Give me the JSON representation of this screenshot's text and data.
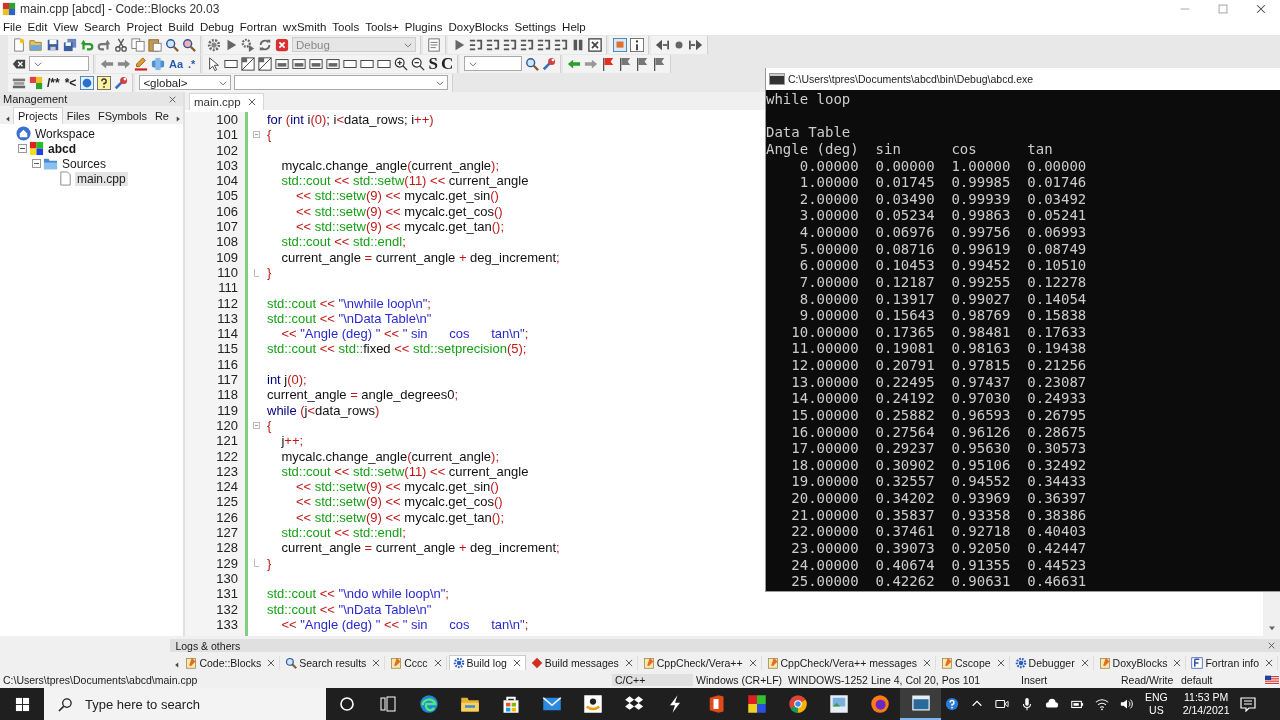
{
  "window": {
    "title": "main.cpp [abcd] - Code::Blocks 20.03"
  },
  "menu": [
    "File",
    "Edit",
    "View",
    "Search",
    "Project",
    "Build",
    "Debug",
    "Fortran",
    "wxSmith",
    "Tools",
    "Tools+",
    "Plugins",
    "DoxyBlocks",
    "Settings",
    "Help"
  ],
  "toolbar": {
    "build_target": "Debug",
    "match_case": "Aa",
    "regex": ".*",
    "letter_s": "S",
    "letter_c": "C",
    "doc_block": "/**",
    "doc_inline": "*<",
    "scope": "<global>"
  },
  "management": {
    "title": "Management",
    "tabs": [
      {
        "label": "Projects",
        "selected": true
      },
      {
        "label": "Files",
        "selected": false
      },
      {
        "label": "FSymbols",
        "selected": false
      },
      {
        "label": "Re",
        "selected": false
      }
    ],
    "tree": [
      {
        "label": "Workspace",
        "kind": "workspace",
        "selected": false,
        "children": [
          {
            "label": "abcd",
            "kind": "project",
            "selected": false,
            "expanded": true,
            "children": [
              {
                "label": "Sources",
                "kind": "folder",
                "selected": false,
                "expanded": true,
                "children": [
                  {
                    "label": "main.cpp",
                    "kind": "file",
                    "selected": true
                  }
                ]
              }
            ]
          }
        ]
      }
    ]
  },
  "editor": {
    "tabs": [
      {
        "label": "main.cpp",
        "selected": true
      }
    ],
    "lines": [
      {
        "number": "100",
        "tokens": [
          {
            "text": "for ",
            "kind": "keyword"
          },
          {
            "text": "(",
            "kind": "operator"
          },
          {
            "text": "int",
            "kind": "keyword"
          },
          {
            "text": " i",
            "kind": "plain"
          },
          {
            "text": "(0)",
            "kind": "operator"
          },
          {
            "text": "; i",
            "kind": "plain"
          },
          {
            "text": "<",
            "kind": "operator"
          },
          {
            "text": "data_rows; i",
            "kind": "plain"
          },
          {
            "text": "++)",
            "kind": "operator"
          }
        ]
      },
      {
        "number": "101",
        "fold_open": true,
        "tokens": [
          {
            "text": "{",
            "kind": "operator"
          }
        ]
      },
      {
        "number": "102"
      },
      {
        "number": "103",
        "tokens": [
          {
            "text": "    mycalc.change_angle",
            "kind": "plain"
          },
          {
            "text": "(",
            "kind": "operator"
          },
          {
            "text": "current_angle",
            "kind": "plain"
          },
          {
            "text": ");",
            "kind": "operator"
          }
        ]
      },
      {
        "number": "104",
        "tokens": [
          {
            "text": "    std::cout ",
            "kind": "library"
          },
          {
            "text": "<< ",
            "kind": "operator"
          },
          {
            "text": "std::setw",
            "kind": "library"
          },
          {
            "text": "(11) <<",
            "kind": "operator"
          },
          {
            "text": " current_angle",
            "kind": "plain"
          }
        ]
      },
      {
        "number": "105",
        "tokens": [
          {
            "text": "        << ",
            "kind": "operator"
          },
          {
            "text": "std::setw",
            "kind": "library"
          },
          {
            "text": "(9) <<",
            "kind": "operator"
          },
          {
            "text": " mycalc.get_sin",
            "kind": "plain"
          },
          {
            "text": "()",
            "kind": "operator"
          }
        ]
      },
      {
        "number": "106",
        "tokens": [
          {
            "text": "        << ",
            "kind": "operator"
          },
          {
            "text": "std::setw",
            "kind": "library"
          },
          {
            "text": "(9) <<",
            "kind": "operator"
          },
          {
            "text": " mycalc.get_cos",
            "kind": "plain"
          },
          {
            "text": "()",
            "kind": "operator"
          }
        ]
      },
      {
        "number": "107",
        "tokens": [
          {
            "text": "        << ",
            "kind": "operator"
          },
          {
            "text": "std::setw",
            "kind": "library"
          },
          {
            "text": "(9) <<",
            "kind": "operator"
          },
          {
            "text": " mycalc.get_tan",
            "kind": "plain"
          },
          {
            "text": "();",
            "kind": "operator"
          }
        ]
      },
      {
        "number": "108",
        "tokens": [
          {
            "text": "    std::cout ",
            "kind": "library"
          },
          {
            "text": "<< ",
            "kind": "operator"
          },
          {
            "text": "std::endl",
            "kind": "library"
          },
          {
            "text": ";",
            "kind": "operator"
          }
        ]
      },
      {
        "number": "109",
        "tokens": [
          {
            "text": "    current_angle ",
            "kind": "plain"
          },
          {
            "text": "=",
            "kind": "operator"
          },
          {
            "text": " current_angle ",
            "kind": "plain"
          },
          {
            "text": "+",
            "kind": "operator"
          },
          {
            "text": " deg_increment",
            "kind": "plain"
          },
          {
            "text": ";",
            "kind": "operator"
          }
        ]
      },
      {
        "number": "110",
        "fold_close": true,
        "tokens": [
          {
            "text": "}",
            "kind": "operator"
          }
        ]
      },
      {
        "number": "111"
      },
      {
        "number": "112",
        "tokens": [
          {
            "text": "std::cout ",
            "kind": "library"
          },
          {
            "text": "<< ",
            "kind": "operator"
          },
          {
            "text": "\"\\nwhile loop\\n\"",
            "kind": "string"
          },
          {
            "text": ";",
            "kind": "operator"
          }
        ]
      },
      {
        "number": "113",
        "tokens": [
          {
            "text": "std::cout ",
            "kind": "library"
          },
          {
            "text": "<< ",
            "kind": "operator"
          },
          {
            "text": "\"\\nData Table\\n\"",
            "kind": "string"
          }
        ]
      },
      {
        "number": "114",
        "tokens": [
          {
            "text": "    << ",
            "kind": "operator"
          },
          {
            "text": "\"Angle (deg) \" ",
            "kind": "string"
          },
          {
            "text": "<< ",
            "kind": "operator"
          },
          {
            "text": "\" sin      cos      tan\\n\"",
            "kind": "string"
          },
          {
            "text": ";",
            "kind": "operator"
          }
        ]
      },
      {
        "number": "115",
        "tokens": [
          {
            "text": "std::cout ",
            "kind": "library"
          },
          {
            "text": "<< ",
            "kind": "operator"
          },
          {
            "text": "std::",
            "kind": "library"
          },
          {
            "text": "fixed ",
            "kind": "plain"
          },
          {
            "text": "<< ",
            "kind": "operator"
          },
          {
            "text": "std::setprecision",
            "kind": "library"
          },
          {
            "text": "(5);",
            "kind": "operator"
          }
        ]
      },
      {
        "number": "116"
      },
      {
        "number": "117",
        "tokens": [
          {
            "text": "int",
            "kind": "keyword"
          },
          {
            "text": " j",
            "kind": "plain"
          },
          {
            "text": "(0);",
            "kind": "operator"
          }
        ]
      },
      {
        "number": "118",
        "tokens": [
          {
            "text": "current_angle ",
            "kind": "plain"
          },
          {
            "text": "=",
            "kind": "operator"
          },
          {
            "text": " angle_degrees0",
            "kind": "plain"
          },
          {
            "text": ";",
            "kind": "operator"
          }
        ]
      },
      {
        "number": "119",
        "tokens": [
          {
            "text": "while ",
            "kind": "keyword"
          },
          {
            "text": "(",
            "kind": "operator"
          },
          {
            "text": "j",
            "kind": "plain"
          },
          {
            "text": "<",
            "kind": "operator"
          },
          {
            "text": "data_rows",
            "kind": "plain"
          },
          {
            "text": ")",
            "kind": "operator"
          }
        ]
      },
      {
        "number": "120",
        "fold_open": true,
        "tokens": [
          {
            "text": "{",
            "kind": "operator"
          }
        ]
      },
      {
        "number": "121",
        "tokens": [
          {
            "text": "    j",
            "kind": "plain"
          },
          {
            "text": "++;",
            "kind": "operator"
          }
        ]
      },
      {
        "number": "122",
        "tokens": [
          {
            "text": "    mycalc.change_angle",
            "kind": "plain"
          },
          {
            "text": "(",
            "kind": "operator"
          },
          {
            "text": "current_angle",
            "kind": "plain"
          },
          {
            "text": ");",
            "kind": "operator"
          }
        ]
      },
      {
        "number": "123",
        "tokens": [
          {
            "text": "    std::cout ",
            "kind": "library"
          },
          {
            "text": "<< ",
            "kind": "operator"
          },
          {
            "text": "std::setw",
            "kind": "library"
          },
          {
            "text": "(11) <<",
            "kind": "operator"
          },
          {
            "text": " current_angle",
            "kind": "plain"
          }
        ]
      },
      {
        "number": "124",
        "tokens": [
          {
            "text": "        << ",
            "kind": "operator"
          },
          {
            "text": "std::setw",
            "kind": "library"
          },
          {
            "text": "(9) <<",
            "kind": "operator"
          },
          {
            "text": " mycalc.get_sin",
            "kind": "plain"
          },
          {
            "text": "()",
            "kind": "operator"
          }
        ]
      },
      {
        "number": "125",
        "tokens": [
          {
            "text": "        << ",
            "kind": "operator"
          },
          {
            "text": "std::setw",
            "kind": "library"
          },
          {
            "text": "(9) <<",
            "kind": "operator"
          },
          {
            "text": " mycalc.get_cos",
            "kind": "plain"
          },
          {
            "text": "()",
            "kind": "operator"
          }
        ]
      },
      {
        "number": "126",
        "tokens": [
          {
            "text": "        << ",
            "kind": "operator"
          },
          {
            "text": "std::setw",
            "kind": "library"
          },
          {
            "text": "(9) <<",
            "kind": "operator"
          },
          {
            "text": " mycalc.get_tan",
            "kind": "plain"
          },
          {
            "text": "();",
            "kind": "operator"
          }
        ]
      },
      {
        "number": "127",
        "tokens": [
          {
            "text": "    std::cout ",
            "kind": "library"
          },
          {
            "text": "<< ",
            "kind": "operator"
          },
          {
            "text": "std::endl",
            "kind": "library"
          },
          {
            "text": ";",
            "kind": "operator"
          }
        ]
      },
      {
        "number": "128",
        "tokens": [
          {
            "text": "    current_angle ",
            "kind": "plain"
          },
          {
            "text": "=",
            "kind": "operator"
          },
          {
            "text": " current_angle ",
            "kind": "plain"
          },
          {
            "text": "+",
            "kind": "operator"
          },
          {
            "text": " deg_increment",
            "kind": "plain"
          },
          {
            "text": ";",
            "kind": "operator"
          }
        ]
      },
      {
        "number": "129",
        "fold_close": true,
        "tokens": [
          {
            "text": "}",
            "kind": "operator"
          }
        ]
      },
      {
        "number": "130"
      },
      {
        "number": "131",
        "tokens": [
          {
            "text": "std::cout ",
            "kind": "library"
          },
          {
            "text": "<< ",
            "kind": "operator"
          },
          {
            "text": "\"\\ndo while loop\\n\"",
            "kind": "string"
          },
          {
            "text": ";",
            "kind": "operator"
          }
        ]
      },
      {
        "number": "132",
        "tokens": [
          {
            "text": "std::cout ",
            "kind": "library"
          },
          {
            "text": "<< ",
            "kind": "operator"
          },
          {
            "text": "\"\\nData Table\\n\"",
            "kind": "string"
          }
        ]
      },
      {
        "number": "133",
        "tokens": [
          {
            "text": "    << ",
            "kind": "operator"
          },
          {
            "text": "\"Angle (deg) \" ",
            "kind": "string"
          },
          {
            "text": "<< ",
            "kind": "operator"
          },
          {
            "text": "\" sin      cos      tan\\n\"",
            "kind": "string"
          },
          {
            "text": ";",
            "kind": "operator"
          }
        ]
      }
    ]
  },
  "console": {
    "title": "C:\\Users\\tpres\\Documents\\abcd\\bin\\Debug\\abcd.exe",
    "heading": "while loop",
    "table_title": "Data Table",
    "table_header": "Angle (deg)  sin      cos      tan",
    "table_rows": [
      "    0.00000  0.00000  1.00000  0.00000",
      "    1.00000  0.01745  0.99985  0.01746",
      "    2.00000  0.03490  0.99939  0.03492",
      "    3.00000  0.05234  0.99863  0.05241",
      "    4.00000  0.06976  0.99756  0.06993",
      "    5.00000  0.08716  0.99619  0.08749",
      "    6.00000  0.10453  0.99452  0.10510",
      "    7.00000  0.12187  0.99255  0.12278",
      "    8.00000  0.13917  0.99027  0.14054",
      "    9.00000  0.15643  0.98769  0.15838",
      "   10.00000  0.17365  0.98481  0.17633",
      "   11.00000  0.19081  0.98163  0.19438",
      "   12.00000  0.20791  0.97815  0.21256",
      "   13.00000  0.22495  0.97437  0.23087",
      "   14.00000  0.24192  0.97030  0.24933",
      "   15.00000  0.25882  0.96593  0.26795",
      "   16.00000  0.27564  0.96126  0.28675",
      "   17.00000  0.29237  0.95630  0.30573",
      "   18.00000  0.30902  0.95106  0.32492",
      "   19.00000  0.32557  0.94552  0.34433",
      "   20.00000  0.34202  0.93969  0.36397",
      "   21.00000  0.35837  0.93358  0.38386",
      "   22.00000  0.37461  0.92718  0.40403",
      "   23.00000  0.39073  0.92050  0.42447",
      "   24.00000  0.40674  0.91355  0.44523",
      "   25.00000  0.42262  0.90631  0.46631"
    ]
  },
  "logs": {
    "title": "Logs & others",
    "tabs": [
      {
        "label": "Code::Blocks",
        "selected": false
      },
      {
        "label": "Search results",
        "selected": false
      },
      {
        "label": "Cccc",
        "selected": false
      },
      {
        "label": "Build log",
        "selected": true
      },
      {
        "label": "Build messages",
        "selected": false
      },
      {
        "label": "CppCheck/Vera++",
        "selected": false
      },
      {
        "label": "CppCheck/Vera++ messages",
        "selected": false
      },
      {
        "label": "Cscope",
        "selected": false
      },
      {
        "label": "Debugger",
        "selected": false
      },
      {
        "label": "DoxyBlocks",
        "selected": false
      },
      {
        "label": "Fortran info",
        "selected": false
      }
    ]
  },
  "status_bar": {
    "path": "C:\\Users\\tpres\\Documents\\abcd\\main.cpp",
    "language": "C/C++",
    "line_endings": "Windows (CR+LF)",
    "encoding": "WINDOWS-1252",
    "position": "Line 4, Col 20, Pos 101",
    "mode": "Insert",
    "access": "Read/Write",
    "theme": "default"
  },
  "taskbar": {
    "search": {
      "placeholder": "Type here to search"
    },
    "apps": [
      {
        "selected": false
      },
      {
        "selected": false
      },
      {
        "selected": false
      },
      {
        "selected": false
      },
      {
        "selected": false
      },
      {
        "selected": false
      },
      {
        "selected": false
      },
      {
        "selected": false
      },
      {
        "selected": false
      },
      {
        "selected": false
      },
      {
        "selected": false
      },
      {
        "selected": false
      },
      {
        "selected": true
      }
    ],
    "language": "ENG",
    "region": "US",
    "time": "11:53 PM",
    "date": "2/14/2021"
  }
}
